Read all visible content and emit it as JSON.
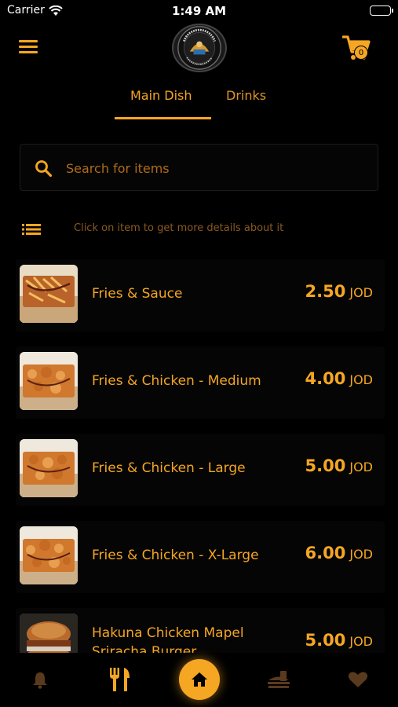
{
  "status_bar": {
    "carrier": "Carrier",
    "time": "1:49 AM"
  },
  "header": {
    "menu_icon": "hamburger-menu-icon",
    "logo_text": "HAKUNA MATATA",
    "cart_icon": "cart-icon",
    "cart_count": "0"
  },
  "tabs": [
    {
      "label": "Main Dish",
      "active": true
    },
    {
      "label": "Drinks",
      "active": false
    }
  ],
  "search": {
    "placeholder": "Search for items",
    "value": ""
  },
  "hint": {
    "icon": "list-icon",
    "text": "Click on item to get more details about it"
  },
  "items": [
    {
      "name": "Fries & Sauce",
      "price": "2.50",
      "currency": "JOD",
      "thumb": "fries"
    },
    {
      "name": "Fries & Chicken - Medium",
      "price": "4.00",
      "currency": "JOD",
      "thumb": "fries-chicken"
    },
    {
      "name": "Fries & Chicken - Large",
      "price": "5.00",
      "currency": "JOD",
      "thumb": "fries-chicken"
    },
    {
      "name": "Fries & Chicken - X-Large",
      "price": "6.00",
      "currency": "JOD",
      "thumb": "fries-chicken"
    },
    {
      "name": "Hakuna Chicken Mapel Sriracha Burger",
      "price": "5.00",
      "currency": "JOD",
      "thumb": "burger"
    }
  ],
  "bottom_nav": [
    {
      "icon": "bell-icon",
      "active": false
    },
    {
      "icon": "cutlery-icon",
      "active": false
    },
    {
      "icon": "home-icon",
      "active": true
    },
    {
      "icon": "dish-icon",
      "active": false
    },
    {
      "icon": "heart-icon",
      "active": false
    }
  ],
  "colors": {
    "accent": "#f5a623",
    "background": "#000000",
    "muted_accent": "#8a5a1e",
    "inactive_nav": "#5a3a1e"
  }
}
